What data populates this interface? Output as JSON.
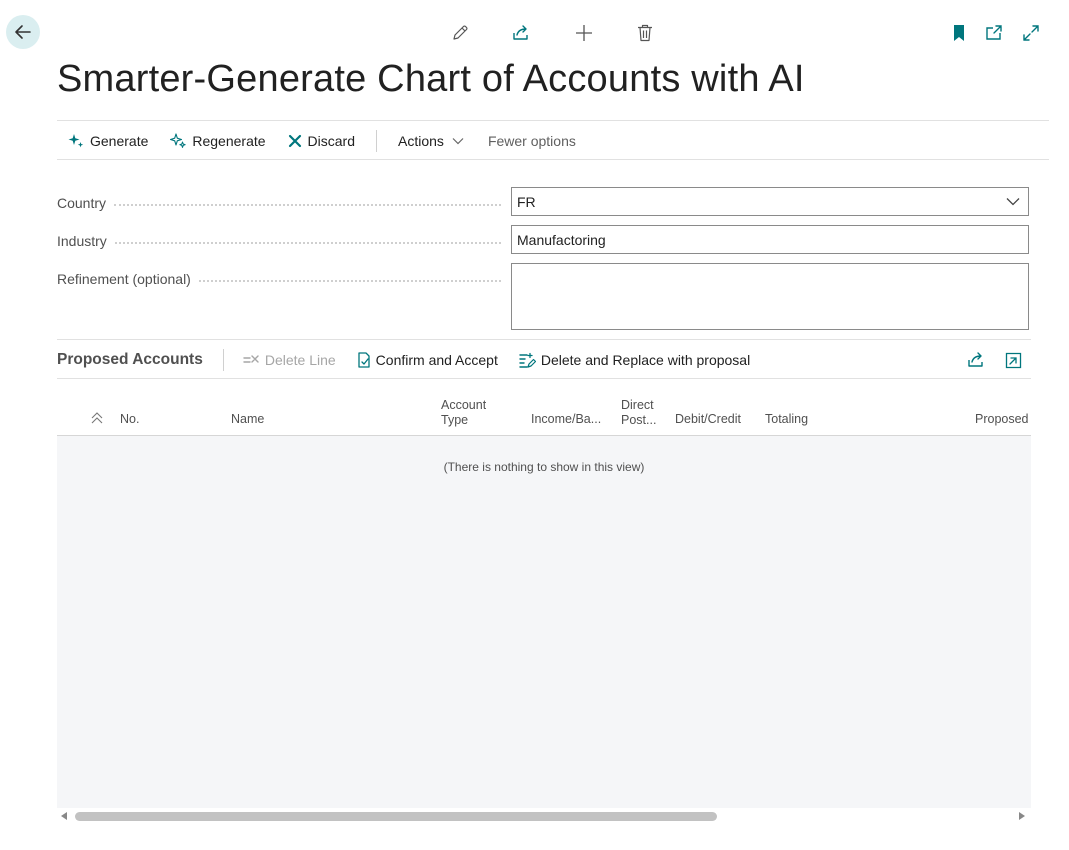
{
  "page": {
    "title": "Smarter-Generate Chart of Accounts with AI",
    "accent_color": "#00767d"
  },
  "top_icons": [
    "back-arrow-icon",
    "pencil-icon",
    "share-icon",
    "plus-icon",
    "trash-icon",
    "bookmark-icon",
    "open-new-window-icon",
    "expand-icon"
  ],
  "actions": {
    "generate": "Generate",
    "regenerate": "Regenerate",
    "discard": "Discard",
    "actions_menu": "Actions",
    "fewer_options": "Fewer options"
  },
  "fields": {
    "country": {
      "label": "Country",
      "value": "FR"
    },
    "industry": {
      "label": "Industry",
      "value": "Manufactoring"
    },
    "refinement": {
      "label": "Refinement (optional)",
      "value": ""
    }
  },
  "proposed": {
    "title": "Proposed Accounts",
    "delete_line": "Delete Line",
    "confirm_accept": "Confirm and Accept",
    "delete_replace": "Delete and Replace with proposal"
  },
  "columns": {
    "no": "No.",
    "name": "Name",
    "account_type_1": "Account",
    "account_type_2": "Type",
    "income_balance": "Income/Ba...",
    "direct_posting_1": "Direct",
    "direct_posting_2": "Post...",
    "debit_credit": "Debit/Credit",
    "totaling": "Totaling",
    "proposed": "Proposed C"
  },
  "grid": {
    "empty_message": "(There is nothing to show in this view)"
  }
}
